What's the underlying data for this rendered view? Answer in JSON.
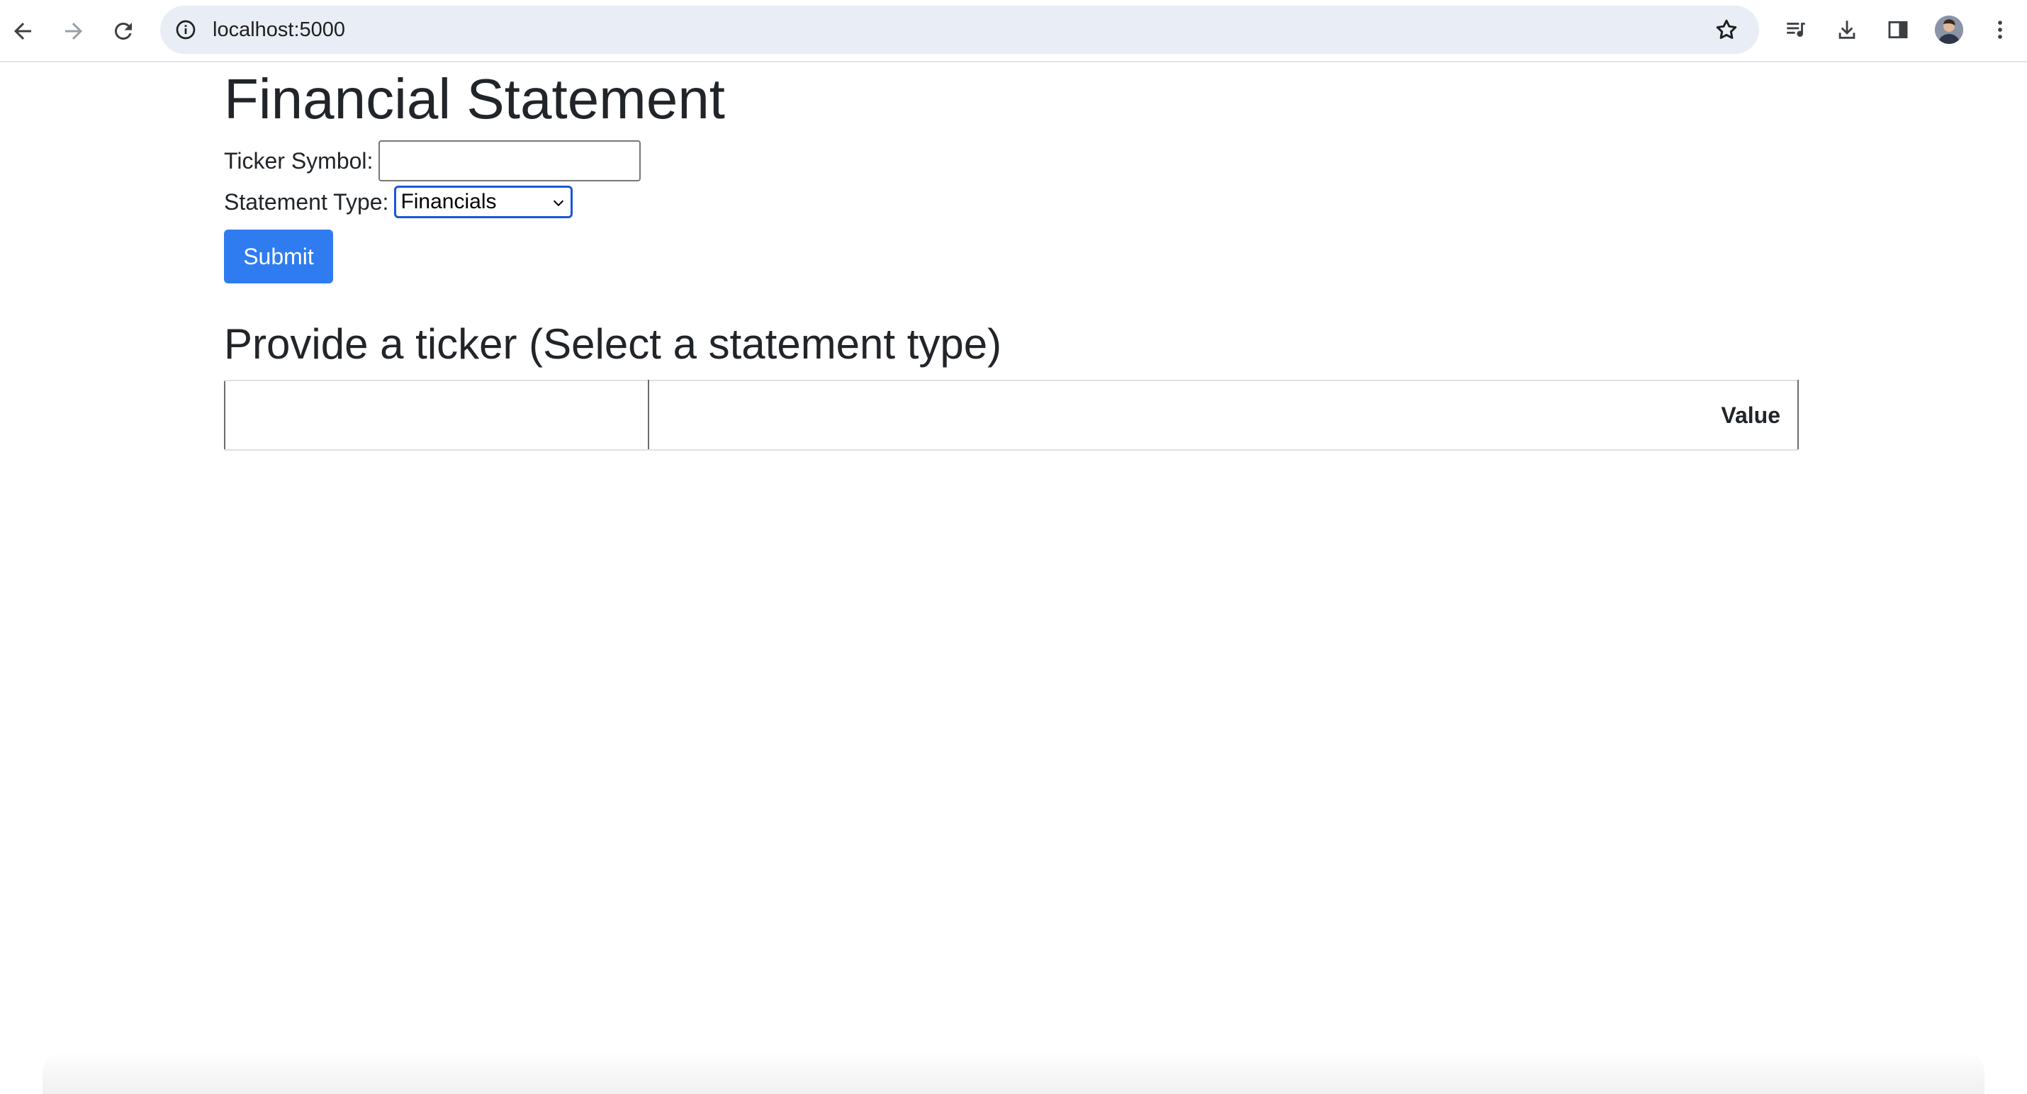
{
  "browser": {
    "url": "localhost:5000"
  },
  "page": {
    "title": "Financial Statement",
    "ticker_label": "Ticker Symbol:",
    "ticker_value": "",
    "statement_label": "Statement Type:",
    "statement_selected": "Financials",
    "submit_label": "Submit",
    "result_heading": "Provide a ticker (Select a statement type)",
    "table": {
      "columns": [
        "",
        "Value"
      ]
    }
  },
  "colors": {
    "submit_bg": "#2f7cf0",
    "select_focus_border": "#1a56db"
  }
}
